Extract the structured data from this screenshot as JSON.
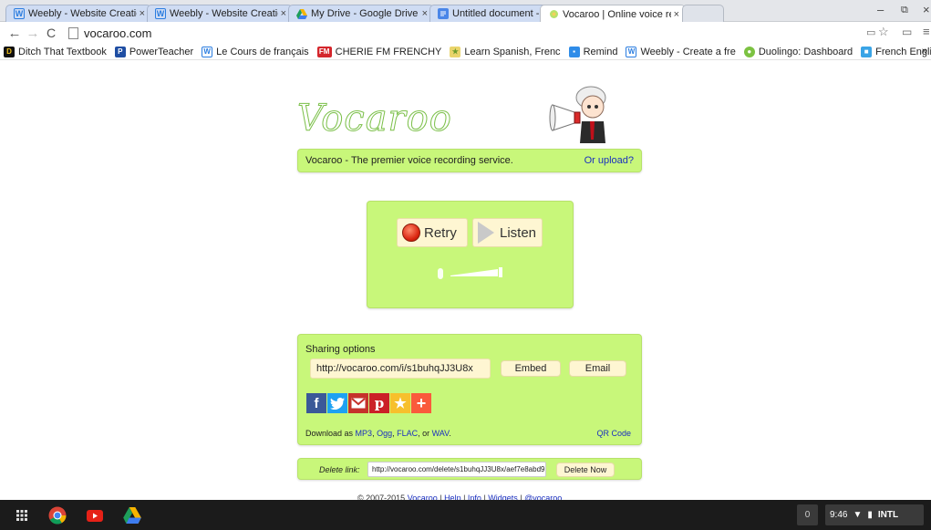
{
  "tabs": [
    {
      "title": "Weebly - Website Creatio",
      "icon": "weebly-icon"
    },
    {
      "title": "Weebly - Website Creatio",
      "icon": "weebly-icon"
    },
    {
      "title": "My Drive - Google Drive",
      "icon": "google-drive-icon"
    },
    {
      "title": "Untitled document - Goo",
      "icon": "google-docs-icon"
    },
    {
      "title": "Vocaroo | Online voice re",
      "icon": "vocaroo-icon",
      "active": true
    }
  ],
  "tab_close": "×",
  "address": "vocaroo.com",
  "bookmarks": [
    {
      "label": "Ditch That Textbook",
      "icon": "ditch-icon",
      "color": "#111111"
    },
    {
      "label": "PowerTeacher",
      "icon": "powerteacher-icon",
      "color": "#1f4ea3"
    },
    {
      "label": "Le Cours de français",
      "icon": "weebly-icon",
      "color": "#2b7de0"
    },
    {
      "label": "CHERIE FM FRENCHY",
      "icon": "cherie-icon",
      "color": "#d4262c"
    },
    {
      "label": "Learn Spanish, Frenc",
      "icon": "learn-icon",
      "color": "#6a9b2d"
    },
    {
      "label": "Remind",
      "icon": "remind-icon",
      "color": "#2f8ce8"
    },
    {
      "label": "Weebly - Create a fre",
      "icon": "weebly-icon",
      "color": "#2b7de0"
    },
    {
      "label": "Duolingo: Dashboard",
      "icon": "duolingo-icon",
      "color": "#7cc242"
    },
    {
      "label": "French English News",
      "icon": "news-icon",
      "color": "#3aa4e6"
    }
  ],
  "bookmarks_more": "»",
  "page": {
    "logo": "Vocaroo",
    "tagline": "Vocaroo - The premier voice recording service.",
    "upload": "Or upload?",
    "retry": "Retry",
    "listen": "Listen",
    "sharing_title": "Sharing options",
    "share_url": "http://vocaroo.com/i/s1buhqJJ3U8x",
    "embed": "Embed",
    "email": "Email",
    "download_prefix": "Download as ",
    "download_formats": {
      "mp3": "MP3",
      "ogg": "Ogg",
      "flac": "FLAC",
      "wav": "WAV"
    },
    "download_sep1": ", ",
    "download_sep2": ", ",
    "download_sep3": ", or ",
    "download_suffix": ".",
    "qr": "QR Code",
    "delete_label": "Delete link:",
    "delete_url": "http://vocaroo.com/delete/s1buhqJJ3U8x/aef7e8abd9",
    "delete_now": "Delete Now",
    "footer_copy": "© 2007-2015 ",
    "footer_links": [
      "Vocaroo",
      "Help",
      "Info",
      "Widgets",
      "@vocaroo"
    ],
    "footer_sep": " | "
  },
  "taskbar": {
    "notifications": "0",
    "time": "9:46",
    "ime": "INTL"
  },
  "colors": {
    "panel": "#c8f77a",
    "button": "#fef6d2",
    "link": "#1a2fbf",
    "facebook": "#3b5998",
    "twitter": "#1da1f2",
    "gmail": "#c5322b",
    "pinterest": "#cb2027",
    "favorite": "#f7c02c",
    "addthis": "#fa5a3c"
  }
}
